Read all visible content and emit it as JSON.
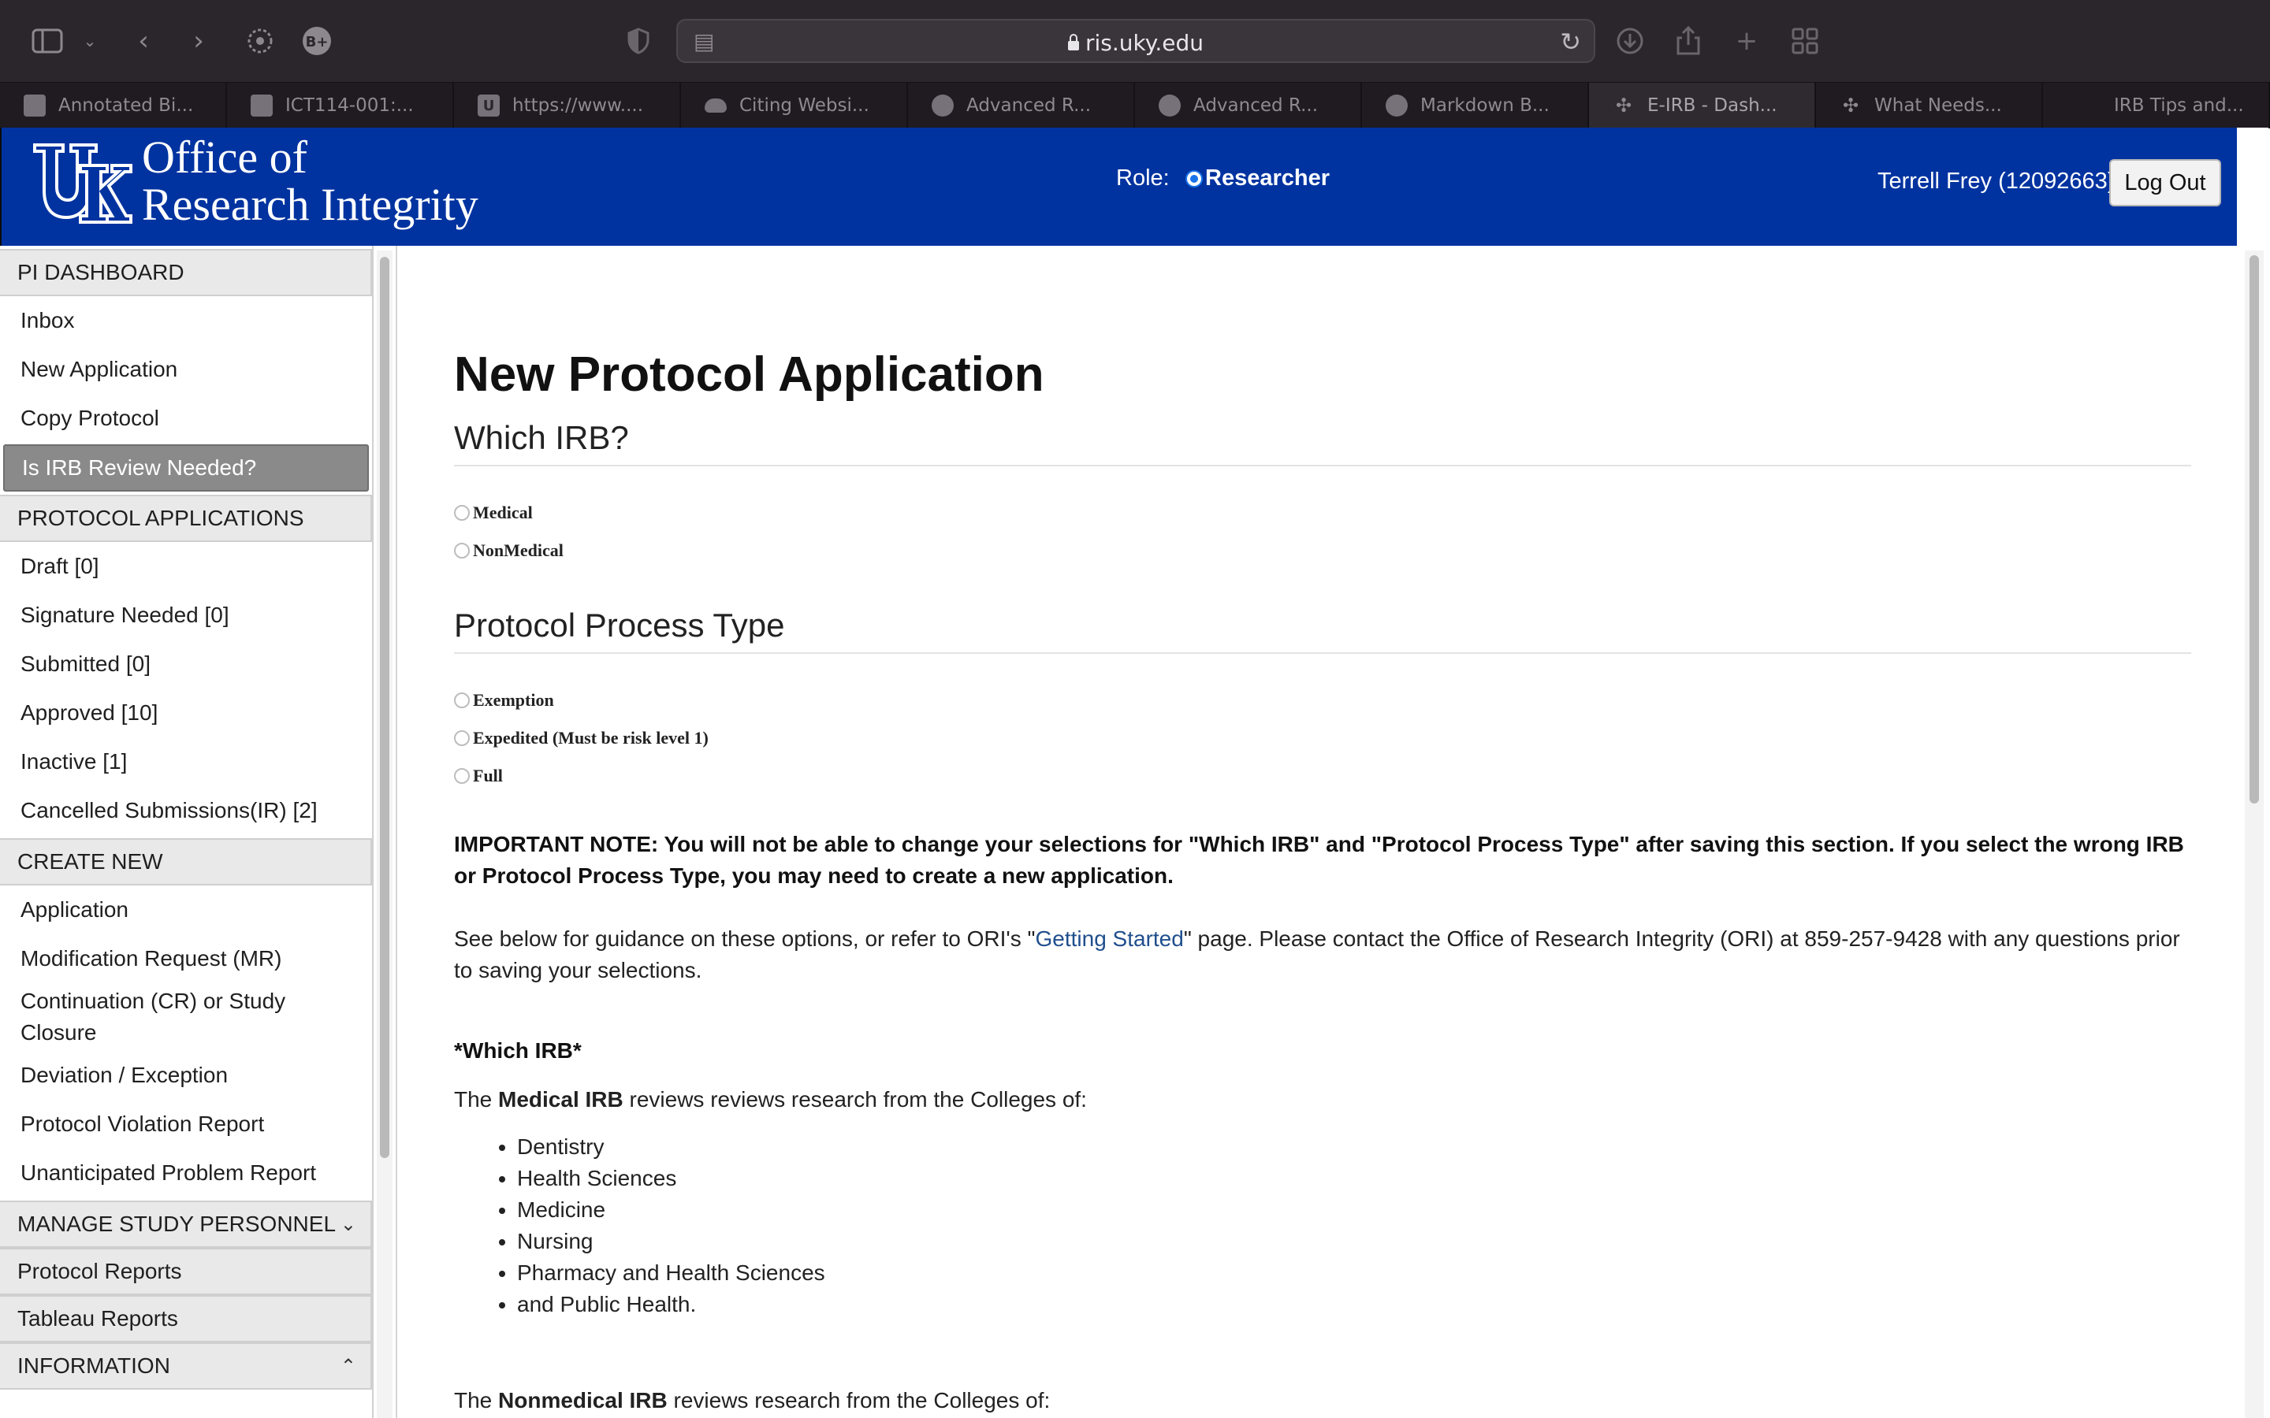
{
  "browser": {
    "url": "ris.uky.edu",
    "tabs": [
      {
        "label": "Annotated Bi..."
      },
      {
        "label": "ICT114-001:..."
      },
      {
        "label": "https://www...."
      },
      {
        "label": "Citing Websi..."
      },
      {
        "label": "Advanced R..."
      },
      {
        "label": "Advanced R..."
      },
      {
        "label": "Markdown B..."
      },
      {
        "label": "E-IRB - Dash..."
      },
      {
        "label": "What Needs..."
      },
      {
        "label": "IRB Tips and..."
      }
    ]
  },
  "header": {
    "org_line1": "Office of",
    "org_line2": "Research Integrity",
    "role_label": "Role:",
    "role_value": "Researcher",
    "user": "Terrell Frey (12092663)",
    "logout_label": "Log Out",
    "brand_color": "#0033a0"
  },
  "sidebar": {
    "pi_dashboard": {
      "title": "PI DASHBOARD",
      "items": [
        "Inbox",
        "New Application",
        "Copy Protocol",
        "Is IRB Review Needed?"
      ]
    },
    "protocol_applications": {
      "title": "PROTOCOL APPLICATIONS",
      "items": [
        "Draft [0]",
        "Signature Needed [0]",
        "Submitted [0]",
        "Approved [10]",
        "Inactive [1]",
        "Cancelled Submissions(IR) [2]"
      ]
    },
    "create_new": {
      "title": "CREATE NEW",
      "items": [
        "Application",
        "Modification Request (MR)",
        "Continuation (CR) or Study Closure",
        "Deviation / Exception",
        "Protocol Violation Report",
        "Unanticipated Problem Report"
      ]
    },
    "manage_personnel": "MANAGE STUDY PERSONNEL",
    "protocol_reports": "Protocol Reports",
    "tableau_reports": "Tableau Reports",
    "information": "INFORMATION"
  },
  "main": {
    "title": "New Protocol Application",
    "which_irb": {
      "heading": "Which IRB?",
      "options": [
        "Medical",
        "NonMedical"
      ]
    },
    "process_type": {
      "heading": "Protocol Process Type",
      "options": [
        "Exemption",
        "Expedited (Must be risk level 1)",
        "Full"
      ]
    },
    "important_note": "IMPORTANT NOTE: You will not be able to change your selections for \"Which IRB\" and \"Protocol Process Type\" after saving this section. If you select the wrong IRB or Protocol Process Type, you may need to create a new application.",
    "guidance_before": "See below for guidance on these options, or refer to ORI's \"",
    "guidance_link": "Getting Started",
    "guidance_after": "\" page. Please contact the Office of Research Integrity (ORI) at 859-257-9428 with any questions prior to saving your selections.",
    "which_irb_subhead": "*Which IRB*",
    "medical_intro_pre": "The ",
    "medical_intro_bold": "Medical IRB",
    "medical_intro_post": " reviews reviews research from the Colleges of:",
    "medical_colleges": [
      "Dentistry",
      "Health Sciences",
      "Medicine",
      "Nursing",
      "Pharmacy and Health Sciences",
      "and Public Health."
    ],
    "nonmedical_intro_pre": "The ",
    "nonmedical_intro_bold": "Nonmedical IRB",
    "nonmedical_intro_post": " reviews research from the Colleges of:"
  }
}
